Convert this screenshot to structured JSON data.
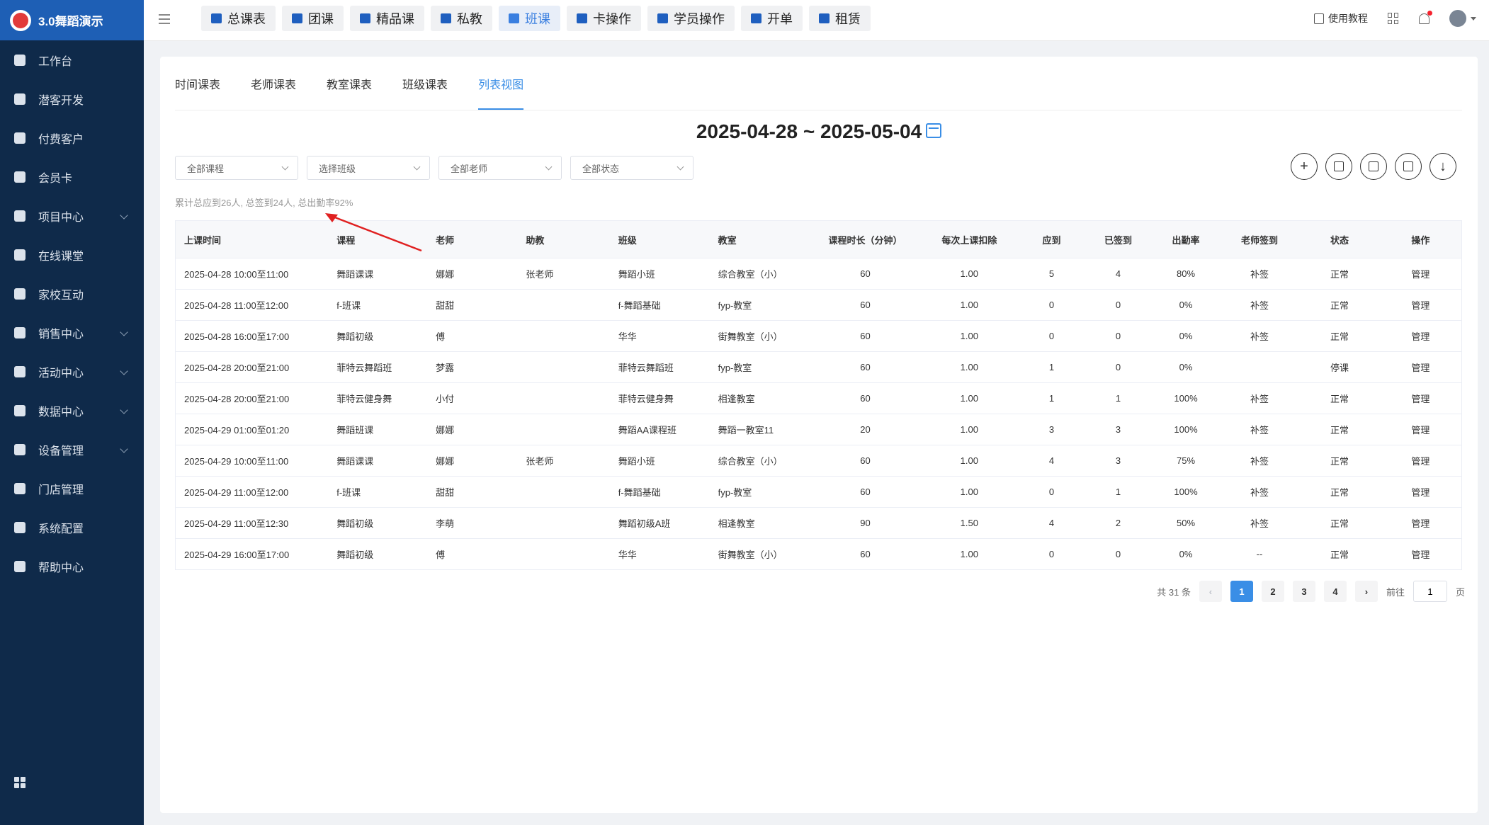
{
  "brand": {
    "title": "3.0舞蹈演示"
  },
  "sidebar": {
    "items": [
      {
        "label": "工作台",
        "icon": "dashboard-icon",
        "has_children": false
      },
      {
        "label": "潜客开发",
        "icon": "prospect-icon",
        "has_children": false
      },
      {
        "label": "付费客户",
        "icon": "customers-icon",
        "has_children": false
      },
      {
        "label": "会员卡",
        "icon": "card-icon",
        "has_children": false
      },
      {
        "label": "项目中心",
        "icon": "project-icon",
        "has_children": true
      },
      {
        "label": "在线课堂",
        "icon": "online-class-icon",
        "has_children": false
      },
      {
        "label": "家校互动",
        "icon": "home-school-icon",
        "has_children": false
      },
      {
        "label": "销售中心",
        "icon": "sales-tag-icon",
        "has_children": true
      },
      {
        "label": "活动中心",
        "icon": "activity-icon",
        "has_children": true
      },
      {
        "label": "数据中心",
        "icon": "pie-chart-icon",
        "has_children": true
      },
      {
        "label": "设备管理",
        "icon": "device-icon",
        "has_children": true
      },
      {
        "label": "门店管理",
        "icon": "store-icon",
        "has_children": false
      },
      {
        "label": "系统配置",
        "icon": "settings-icon",
        "has_children": false
      },
      {
        "label": "帮助中心",
        "icon": "help-icon",
        "has_children": false
      }
    ]
  },
  "topnav": [
    {
      "label": "总课表",
      "active": false
    },
    {
      "label": "团课",
      "active": false
    },
    {
      "label": "精品课",
      "active": false
    },
    {
      "label": "私教",
      "active": false
    },
    {
      "label": "班课",
      "active": true
    },
    {
      "label": "卡操作",
      "active": false
    },
    {
      "label": "学员操作",
      "active": false
    },
    {
      "label": "开单",
      "active": false
    },
    {
      "label": "租赁",
      "active": false
    }
  ],
  "topright": {
    "tutorial": "使用教程"
  },
  "tabs": [
    {
      "label": "时间课表",
      "active": false
    },
    {
      "label": "老师课表",
      "active": false
    },
    {
      "label": "教室课表",
      "active": false
    },
    {
      "label": "班级课表",
      "active": false
    },
    {
      "label": "列表视图",
      "active": true
    }
  ],
  "date_range": "2025-04-28 ~ 2025-05-04",
  "filters": [
    "全部课程",
    "选择班级",
    "全部老师",
    "全部状态"
  ],
  "summary": "累计总应到26人, 总签到24人, 总出勤率92%",
  "table": {
    "headers": [
      "上课时间",
      "课程",
      "老师",
      "助教",
      "班级",
      "教室",
      "课程时长（分钟）",
      "每次上课扣除",
      "应到",
      "已签到",
      "出勤率",
      "老师签到",
      "状态",
      "操作"
    ],
    "rows": [
      [
        "2025-04-28 10:00至11:00",
        "舞蹈课课",
        "娜娜",
        "张老师",
        "舞蹈小班",
        "综合教室（小）",
        "60",
        "1.00",
        "5",
        "4",
        "80%",
        "补签",
        "正常",
        "管理"
      ],
      [
        "2025-04-28 11:00至12:00",
        "f-班课",
        "甜甜",
        "",
        "f-舞蹈基础",
        "fyp-教室",
        "60",
        "1.00",
        "0",
        "0",
        "0%",
        "补签",
        "正常",
        "管理"
      ],
      [
        "2025-04-28 16:00至17:00",
        "舞蹈初级",
        "傅",
        "",
        "华华",
        "街舞教室（小）",
        "60",
        "1.00",
        "0",
        "0",
        "0%",
        "补签",
        "正常",
        "管理"
      ],
      [
        "2025-04-28 20:00至21:00",
        "菲特云舞蹈班",
        "梦露",
        "",
        "菲特云舞蹈班",
        "fyp-教室",
        "60",
        "1.00",
        "1",
        "0",
        "0%",
        "",
        "停课",
        "管理"
      ],
      [
        "2025-04-28 20:00至21:00",
        "菲特云健身舞",
        "小付",
        "",
        "菲特云健身舞",
        "相逢教室",
        "60",
        "1.00",
        "1",
        "1",
        "100%",
        "补签",
        "正常",
        "管理"
      ],
      [
        "2025-04-29 01:00至01:20",
        "舞蹈班课",
        "娜娜",
        "",
        "舞蹈AA课程班",
        "舞蹈一教室11",
        "20",
        "1.00",
        "3",
        "3",
        "100%",
        "补签",
        "正常",
        "管理"
      ],
      [
        "2025-04-29 10:00至11:00",
        "舞蹈课课",
        "娜娜",
        "张老师",
        "舞蹈小班",
        "综合教室（小）",
        "60",
        "1.00",
        "4",
        "3",
        "75%",
        "补签",
        "正常",
        "管理"
      ],
      [
        "2025-04-29 11:00至12:00",
        "f-班课",
        "甜甜",
        "",
        "f-舞蹈基础",
        "fyp-教室",
        "60",
        "1.00",
        "0",
        "1",
        "100%",
        "补签",
        "正常",
        "管理"
      ],
      [
        "2025-04-29 11:00至12:30",
        "舞蹈初级",
        "李萌",
        "",
        "舞蹈初级A班",
        "相逢教室",
        "90",
        "1.50",
        "4",
        "2",
        "50%",
        "补签",
        "正常",
        "管理"
      ],
      [
        "2025-04-29 16:00至17:00",
        "舞蹈初级",
        "傅",
        "",
        "华华",
        "街舞教室（小）",
        "60",
        "1.00",
        "0",
        "0",
        "0%",
        "--",
        "正常",
        "管理"
      ]
    ]
  },
  "pagination": {
    "total": "共 31 条",
    "pages": [
      "1",
      "2",
      "3",
      "4"
    ],
    "current": "1",
    "goto_label": "前往",
    "goto_value": "1",
    "page_unit": "页"
  },
  "colors": {
    "sidebar_bg": "#0f2a4a",
    "brand_bg": "#1e5fb5",
    "accent": "#3a8ee6",
    "stopped": "#f5222d"
  }
}
